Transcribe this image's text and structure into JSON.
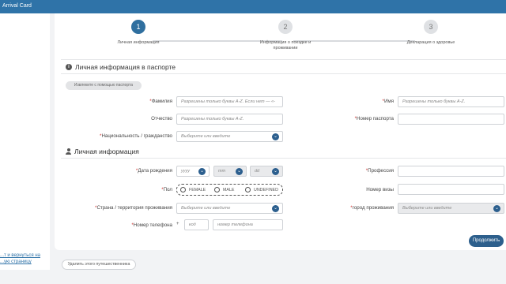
{
  "app": {
    "title": "Arrival Card"
  },
  "sidebar": {
    "back_link": "...т и вернуться на\n...ую страницу"
  },
  "stepper": {
    "steps": [
      {
        "number": "1",
        "label": "Личная информация"
      },
      {
        "number": "2",
        "label": "Информация о поездке и проживании"
      },
      {
        "number": "3",
        "label": "Декларация о здоровье"
      }
    ]
  },
  "passport_section": {
    "title": "Личная информация в паспорте",
    "extract_button": "Извлеките с помощью паспорта",
    "required_mark": "*",
    "surname_label": "Фамилия",
    "surname_placeholder": "Разрешены только буквы A-Z. Если нет — «-",
    "name_label": "Имя",
    "name_placeholder": "Разрешены только буквы A-Z.",
    "patronymic_label": "Отчество",
    "patronymic_placeholder": "Разрешены только буквы A-Z.",
    "passport_label": "Номер паспорта",
    "nationality_label": "Национальность / гражданство",
    "nationality_placeholder": "Выберите или введите"
  },
  "personal_section": {
    "title": "Личная информация",
    "birth_label": "Дата рождения",
    "year_placeholder": "yyyy",
    "month_placeholder": "mm",
    "day_placeholder": "dd",
    "profession_label": "Профессия",
    "gender_label": "Пол",
    "gender_options": [
      "FEMALE",
      "MALE",
      "UNDEFINED"
    ],
    "visa_label": "Номер визы",
    "country_label": "Страна / территория проживания",
    "country_placeholder": "Выберите или введите",
    "city_label": "город проживания",
    "city_placeholder": "Выберите или введите",
    "phone_label": "Номер телефона",
    "phone_plus": "+",
    "code_placeholder": "код",
    "phone_placeholder": "номер телефона"
  },
  "actions": {
    "continue": "Продолжить",
    "delete_traveler": "Удалить этого путешественника"
  },
  "colors": {
    "topbar": "#2f73a8",
    "primary": "#2d5f8c",
    "required": "#d0322f"
  },
  "icons": [
    "info-icon",
    "person-icon",
    "chevron-down-icon"
  ]
}
